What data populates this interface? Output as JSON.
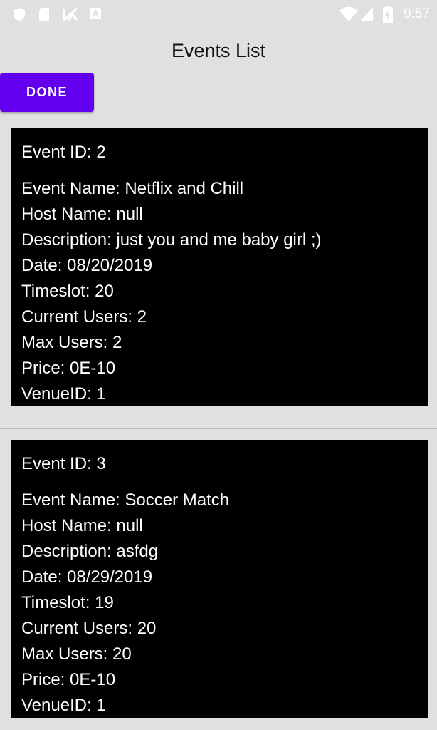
{
  "status_bar": {
    "time": "9:57",
    "icons": [
      "shield-icon",
      "sd-card-icon",
      "no-signal-icon",
      "a-icon",
      "wifi-icon",
      "cell-signal-icon",
      "battery-charging-icon"
    ]
  },
  "header": {
    "title": "Events List"
  },
  "actions": {
    "done_label": "DONE"
  },
  "colors": {
    "accent": "#6200ee",
    "card_bg": "#000000",
    "page_bg": "#e0e0e0"
  },
  "events": [
    {
      "id_line": "Event ID: 2",
      "name_line": "Event Name: Netflix and Chill",
      "host_line": "Host Name: null",
      "description_line": "Description: just you and me baby girl ;)",
      "date_line": "Date: 08/20/2019",
      "timeslot_line": "Timeslot: 20",
      "current_users_line": "Current Users: 2",
      "max_users_line": "Max Users: 2",
      "price_line": "Price: 0E-10",
      "venue_line": "VenueID: 1"
    },
    {
      "id_line": "Event ID: 3",
      "name_line": "Event Name: Soccer Match",
      "host_line": "Host Name: null",
      "description_line": "Description: asfdg",
      "date_line": "Date: 08/29/2019",
      "timeslot_line": "Timeslot: 19",
      "current_users_line": "Current Users: 20",
      "max_users_line": "Max Users: 20",
      "price_line": "Price: 0E-10",
      "venue_line": "VenueID: 1"
    }
  ]
}
